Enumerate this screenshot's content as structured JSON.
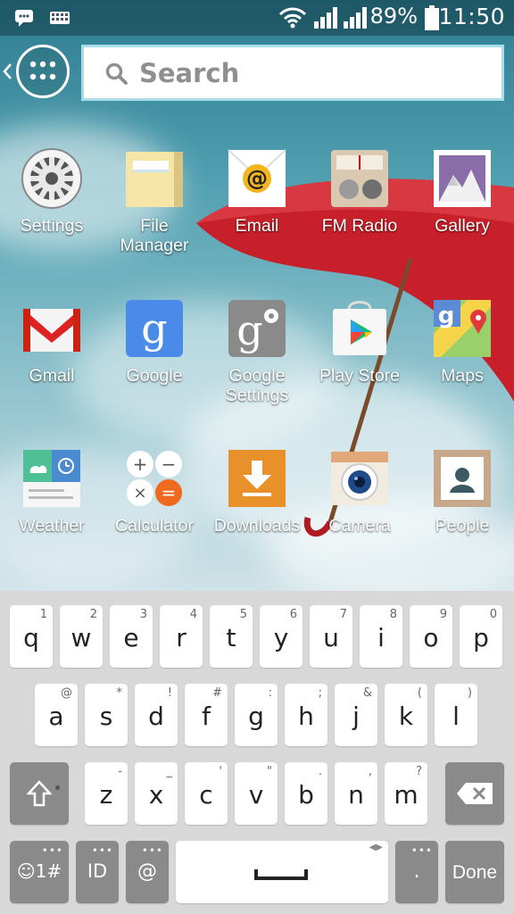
{
  "status_bar": {
    "battery_percent": "89%",
    "time": "11:50"
  },
  "search": {
    "placeholder": "Search"
  },
  "apps": [
    {
      "label": "Settings",
      "icon": "settings-icon"
    },
    {
      "label": "File\nManager",
      "icon": "file-manager-icon"
    },
    {
      "label": "Email",
      "icon": "email-icon"
    },
    {
      "label": "FM Radio",
      "icon": "fm-radio-icon"
    },
    {
      "label": "Gallery",
      "icon": "gallery-icon"
    },
    {
      "label": "Gmail",
      "icon": "gmail-icon"
    },
    {
      "label": "Google",
      "icon": "google-icon"
    },
    {
      "label": "Google\nSettings",
      "icon": "google-settings-icon"
    },
    {
      "label": "Play Store",
      "icon": "play-store-icon"
    },
    {
      "label": "Maps",
      "icon": "maps-icon"
    },
    {
      "label": "Weather",
      "icon": "weather-icon"
    },
    {
      "label": "Calculator",
      "icon": "calculator-icon"
    },
    {
      "label": "Downloads",
      "icon": "downloads-icon"
    },
    {
      "label": "Camera",
      "icon": "camera-icon"
    },
    {
      "label": "People",
      "icon": "people-icon"
    }
  ],
  "keyboard": {
    "row1": [
      {
        "ch": "q",
        "sup": "1"
      },
      {
        "ch": "w",
        "sup": "2"
      },
      {
        "ch": "e",
        "sup": "3"
      },
      {
        "ch": "r",
        "sup": "4"
      },
      {
        "ch": "t",
        "sup": "5"
      },
      {
        "ch": "y",
        "sup": "6"
      },
      {
        "ch": "u",
        "sup": "7"
      },
      {
        "ch": "i",
        "sup": "8"
      },
      {
        "ch": "o",
        "sup": "9"
      },
      {
        "ch": "p",
        "sup": "0"
      }
    ],
    "row2": [
      {
        "ch": "a",
        "sup": "@"
      },
      {
        "ch": "s",
        "sup": "*"
      },
      {
        "ch": "d",
        "sup": "!"
      },
      {
        "ch": "f",
        "sup": "#"
      },
      {
        "ch": "g",
        "sup": ":"
      },
      {
        "ch": "h",
        "sup": ";"
      },
      {
        "ch": "j",
        "sup": "&"
      },
      {
        "ch": "k",
        "sup": "("
      },
      {
        "ch": "l",
        "sup": ")"
      }
    ],
    "row3": [
      {
        "ch": "z",
        "sup": "-"
      },
      {
        "ch": "x",
        "sup": "_"
      },
      {
        "ch": "c",
        "sup": "'"
      },
      {
        "ch": "v",
        "sup": "\""
      },
      {
        "ch": "b",
        "sup": "."
      },
      {
        "ch": "n",
        "sup": ","
      },
      {
        "ch": "m",
        "sup": "?"
      }
    ],
    "symbols_label": "☺1#",
    "lang_label": "ID",
    "at_label": "@",
    "period_label": ".",
    "done_label": "Done"
  },
  "colors": {
    "accent": "#a7dde8",
    "umbrella": "#c8202a"
  }
}
